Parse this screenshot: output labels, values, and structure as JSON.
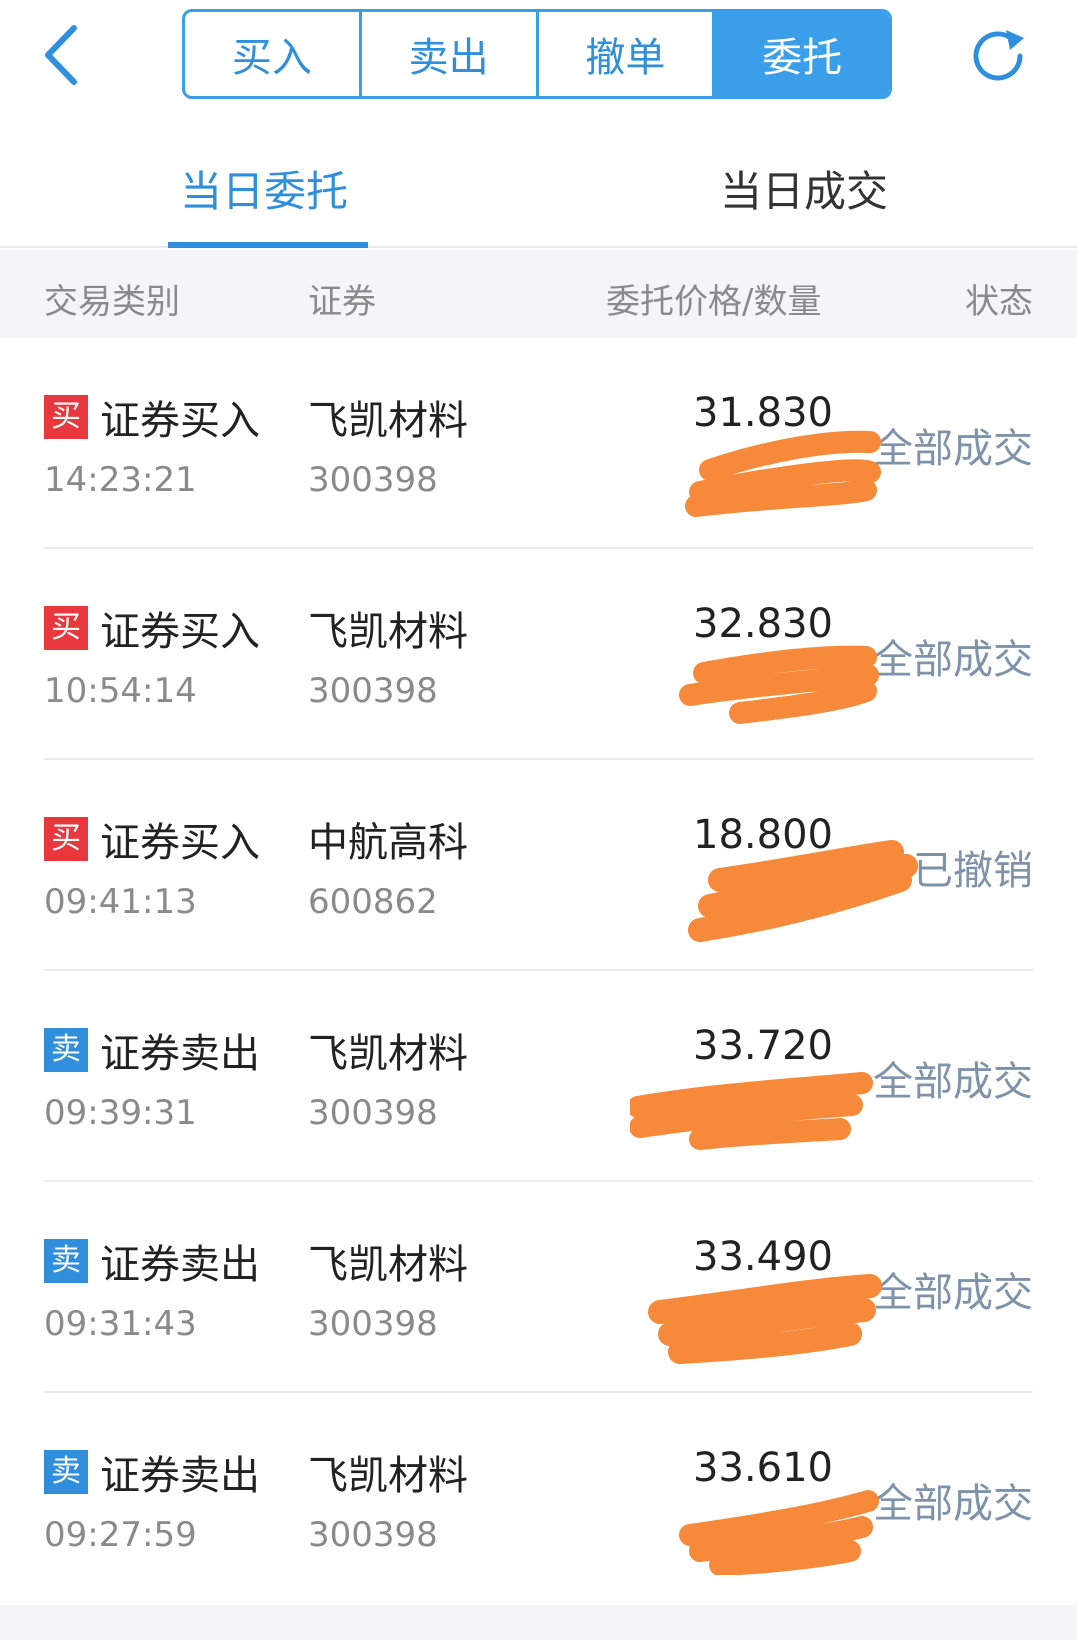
{
  "topbar": {
    "back_icon": "chevron-left-icon",
    "refresh_icon": "refresh-icon",
    "segments": [
      {
        "label": "买入",
        "active": false
      },
      {
        "label": "卖出",
        "active": false
      },
      {
        "label": "撤单",
        "active": false
      },
      {
        "label": "委托",
        "active": true
      }
    ],
    "accent_color": "#3a9ee8"
  },
  "subtabs": {
    "today_orders": "当日委托",
    "today_deals": "当日成交",
    "active": "today_orders"
  },
  "columns": {
    "type": "交易类别",
    "security": "证券",
    "price_qty": "委托价格/数量",
    "status": "状态"
  },
  "rows": [
    {
      "badge": "买",
      "side": "buy",
      "type": "证券买入",
      "time": "14:23:21",
      "name": "飞凯材料",
      "code": "300398",
      "price": "31.830",
      "status": "全部成交"
    },
    {
      "badge": "买",
      "side": "buy",
      "type": "证券买入",
      "time": "10:54:14",
      "name": "飞凯材料",
      "code": "300398",
      "price": "32.830",
      "status": "全部成交"
    },
    {
      "badge": "买",
      "side": "buy",
      "type": "证券买入",
      "time": "09:41:13",
      "name": "中航高科",
      "code": "600862",
      "price": "18.800",
      "status": "已撤销"
    },
    {
      "badge": "卖",
      "side": "sell",
      "type": "证券卖出",
      "time": "09:39:31",
      "name": "飞凯材料",
      "code": "300398",
      "price": "33.720",
      "status": "全部成交"
    },
    {
      "badge": "卖",
      "side": "sell",
      "type": "证券卖出",
      "time": "09:31:43",
      "name": "飞凯材料",
      "code": "300398",
      "price": "33.490",
      "status": "全部成交"
    },
    {
      "badge": "卖",
      "side": "sell",
      "type": "证券卖出",
      "time": "09:27:59",
      "name": "飞凯材料",
      "code": "300398",
      "price": "33.610",
      "status": "全部成交"
    }
  ],
  "colors": {
    "buy_badge": "#e8383d",
    "sell_badge": "#2f8fdc",
    "redaction": "#f6893a"
  }
}
